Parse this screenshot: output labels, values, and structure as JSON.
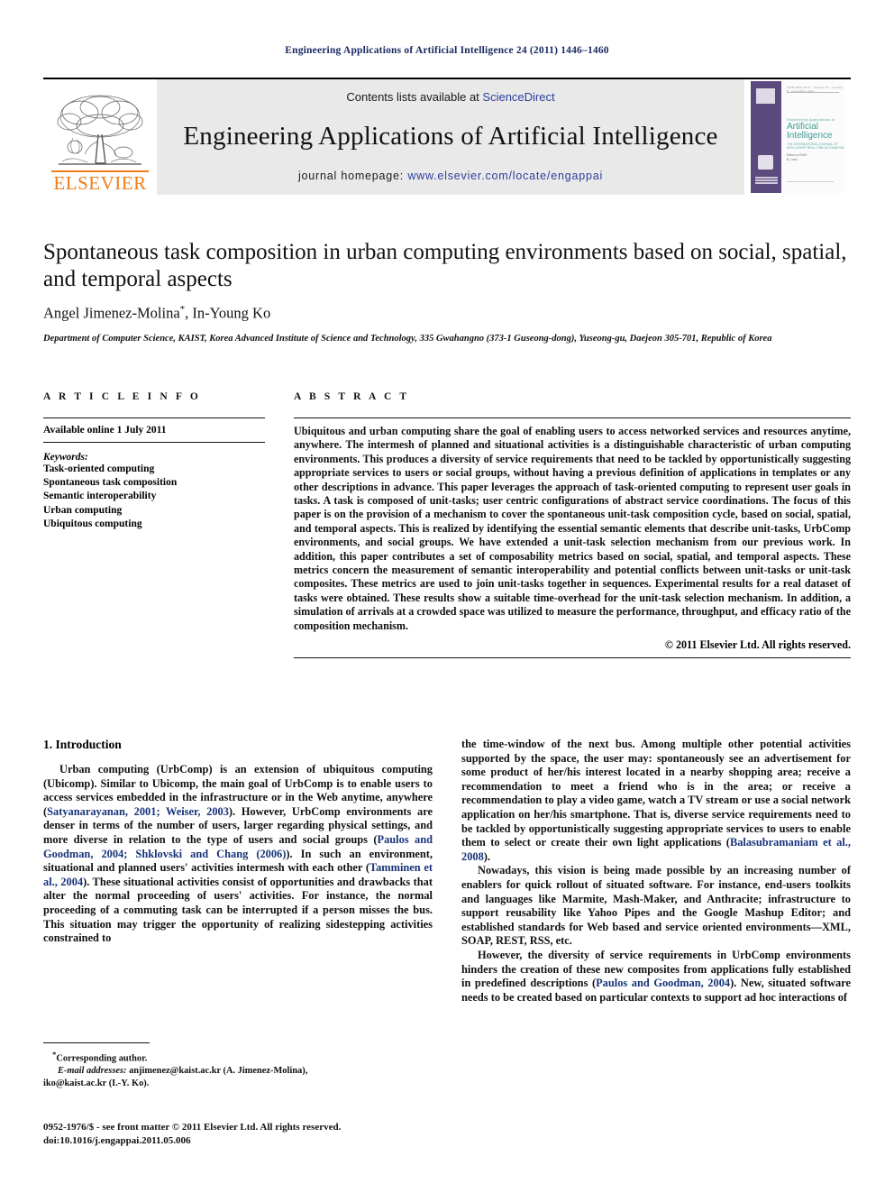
{
  "running_head": "Engineering Applications of Artificial Intelligence 24 (2011) 1446–1460",
  "masthead": {
    "publisher": "ELSEVIER",
    "contents_prefix": "Contents lists available at ",
    "contents_link": "ScienceDirect",
    "journal_name": "Engineering Applications of Artificial Intelligence",
    "homepage_prefix": "journal homepage: ",
    "homepage_url": "www.elsevier.com/locate/engappai",
    "cover": {
      "kicker": "Engineering Applications of",
      "title_line1": "Artificial",
      "title_line2": "Intelligence",
      "subtitle": "THE INTERNATIONAL JOURNAL OF INTELLIGENT REAL-TIME AUTOMATION",
      "meta_line1": "Editor-in-Chief",
      "meta_line2": "B. Lees",
      "top_eyebrow": "ISSN 0952-1976 · Volume 24 · Number 8 · December 2011",
      "colors": {
        "band": "#5b4a7e",
        "title": "#3f9b93"
      }
    }
  },
  "article": {
    "title": "Spontaneous task composition in urban computing environments based on social, spatial, and temporal aspects",
    "authors": "Angel Jimenez-Molina",
    "author_marker": "*",
    "authors_rest": ", In-Young Ko",
    "affiliation": "Department of Computer Science, KAIST, Korea Advanced Institute of Science and Technology, 335 Gwahangno (373-1 Guseong-dong), Yuseong-gu, Daejeon 305-701, Republic of Korea"
  },
  "article_info": {
    "heading": "A R T I C L E   I N F O",
    "available_online": "Available online 1 July 2011",
    "keywords_label": "Keywords:",
    "keywords": [
      "Task-oriented computing",
      "Spontaneous task composition",
      "Semantic interoperability",
      "Urban computing",
      "Ubiquitous computing"
    ]
  },
  "abstract": {
    "heading": "A B S T R A C T",
    "text": "Ubiquitous and urban computing share the goal of enabling users to access networked services and resources anytime, anywhere. The intermesh of planned and situational activities is a distinguishable characteristic of urban computing environments. This produces a diversity of service requirements that need to be tackled by opportunistically suggesting appropriate services to users or social groups, without having a previous definition of applications in templates or any other descriptions in advance. This paper leverages the approach of task-oriented computing to represent user goals in tasks. A task is composed of unit-tasks; user centric configurations of abstract service coordinations. The focus of this paper is on the provision of a mechanism to cover the spontaneous unit-task composition cycle, based on social, spatial, and temporal aspects. This is realized by identifying the essential semantic elements that describe unit-tasks, UrbComp environments, and social groups. We have extended a unit-task selection mechanism from our previous work. In addition, this paper contributes a set of composability metrics based on social, spatial, and temporal aspects. These metrics concern the measurement of semantic interoperability and potential conflicts between unit-tasks or unit-task composites. These metrics are used to join unit-tasks together in sequences. Experimental results for a real dataset of tasks were obtained. These results show a suitable time-overhead for the unit-task selection mechanism. In addition, a simulation of arrivals at a crowded space was utilized to measure the performance, throughput, and efficacy ratio of the composition mechanism.",
    "copyright": "© 2011 Elsevier Ltd. All rights reserved."
  },
  "introduction": {
    "heading": "1. Introduction",
    "left_paragraph_1": "Urban computing (UrbComp) is an extension of ubiquitous computing (Ubicomp). Similar to Ubicomp, the main goal of UrbComp is to enable users to access services embedded in the infrastructure or in the Web anytime, anywhere (Satyanarayanan, 2001; Weiser, 2003). However, UrbComp environments are denser in terms of the number of users, larger regarding physical settings, and more diverse in relation to the type of users and social groups (Paulos and Goodman, 2004; Shklovski and Chang (2006)). In such an environment, situational and planned users' activities intermesh with each other (Tamminen et al., 2004). These situational activities consist of opportunities and drawbacks that alter the normal proceeding of users' activities. For instance, the normal proceeding of a commuting task can be interrupted if a person misses the bus. This situation may trigger the opportunity of realizing sidestepping activities constrained to",
    "right_paragraph_1": "the time-window of the next bus. Among multiple other potential activities supported by the space, the user may: spontaneously see an advertisement for some product of her/his interest located in a nearby shopping area; receive a recommendation to meet a friend who is in the area; or receive a recommendation to play a video game, watch a TV stream or use a social network application on her/his smartphone. That is, diverse service requirements need to be tackled by opportunistically suggesting appropriate services to users to enable them to select or create their own light applications (Balasubramaniam et al., 2008).",
    "right_paragraph_2": "Nowadays, this vision is being made possible by an increasing number of enablers for quick rollout of situated software. For instance, end-users toolkits and languages like Marmite, Mash-Maker, and Anthracite; infrastructure to support reusability like Yahoo Pipes and the Google Mashup Editor; and established standards for Web based and service oriented environments—XML, SOAP, REST, RSS, etc.",
    "right_paragraph_3": "However, the diversity of service requirements in UrbComp environments hinders the creation of these new composites from applications fully established in predefined descriptions (Paulos and Goodman, 2004). New, situated software needs to be created based on particular contexts to support ad hoc interactions of"
  },
  "footnote": {
    "corresponding": "Corresponding author.",
    "email_label": "E-mail addresses:",
    "email_line1": " anjimenez@kaist.ac.kr (A. Jimenez-Molina),",
    "email_line2": "iko@kaist.ac.kr (I.-Y. Ko)."
  },
  "footer": {
    "issn_line": "0952-1976/$ - see front matter © 2011 Elsevier Ltd. All rights reserved.",
    "doi_line": "doi:10.1016/j.engappai.2011.05.006"
  },
  "colors": {
    "running_head": "#1b2a63",
    "link": "#2b3f9e",
    "citation": "#17347a",
    "elsevier_orange": "#f07c17",
    "band_gray": "#e9e9e9"
  }
}
